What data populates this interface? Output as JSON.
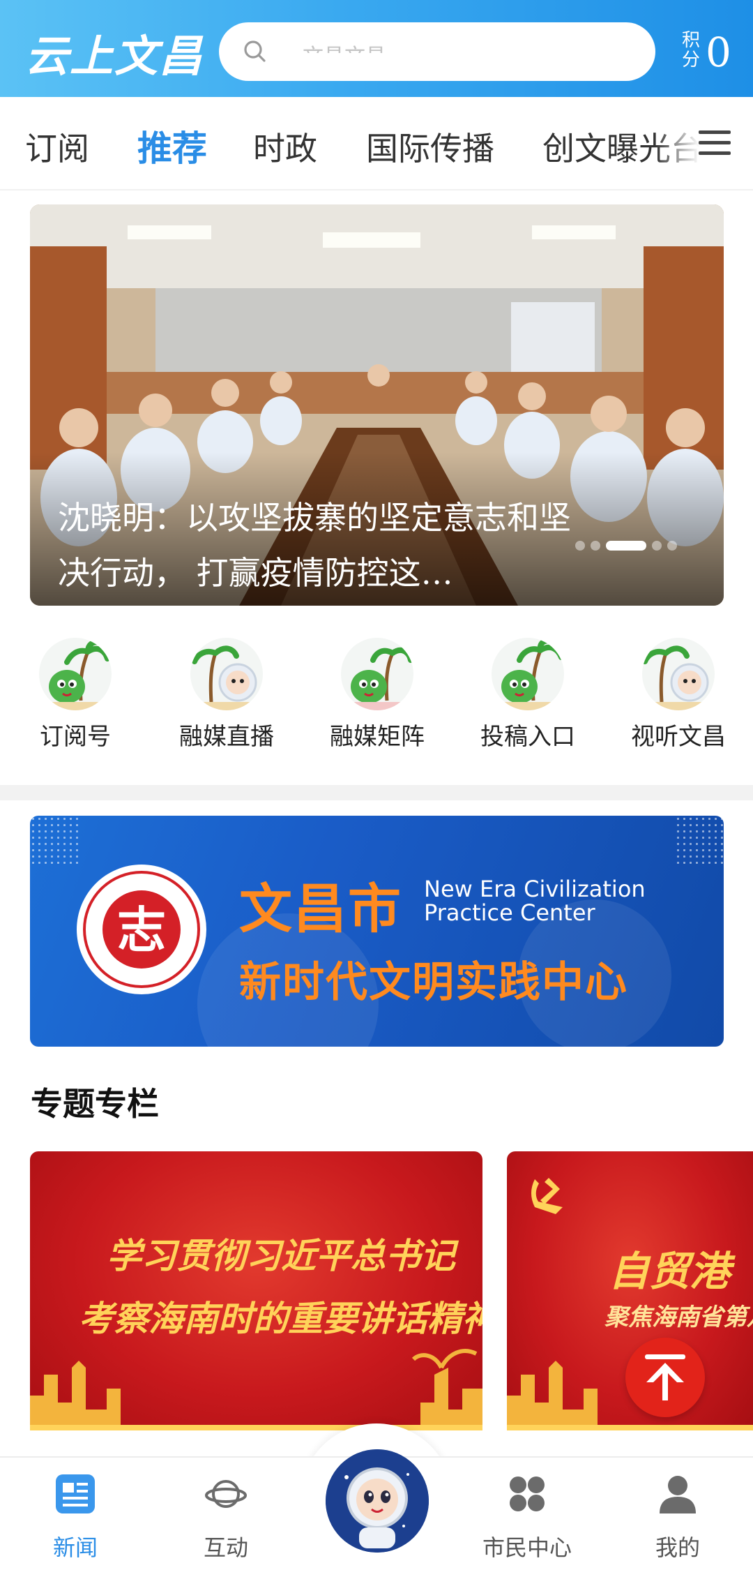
{
  "header": {
    "logo_text": "云上文昌",
    "search_placeholder": "文昌文昌",
    "score_label": "积分",
    "score_value": "0",
    "brand_color": "#2a8de6"
  },
  "tabs": [
    {
      "label": "订阅",
      "active": false
    },
    {
      "label": "推荐",
      "active": true
    },
    {
      "label": "时政",
      "active": false
    },
    {
      "label": "国际传播",
      "active": false
    },
    {
      "label": "创文曝光台",
      "active": false
    }
  ],
  "carousel": {
    "caption": "沈晓明：以攻坚拔寨的坚定意志和坚决行动， 打赢疫情防控这…",
    "slide_count": 5,
    "active_slide": 3
  },
  "quick_links": [
    {
      "label": "订阅号",
      "icon": "mascot-palm-icon"
    },
    {
      "label": "融媒直播",
      "icon": "mascot-astronaut-icon"
    },
    {
      "label": "融媒矩阵",
      "icon": "mascot-palm-icon"
    },
    {
      "label": "投稿入口",
      "icon": "mascot-palm-icon"
    },
    {
      "label": "视听文昌",
      "icon": "mascot-astronaut-icon"
    }
  ],
  "banner": {
    "title": "文昌市",
    "subtitle": "新时代文明实践中心",
    "english_line1": "New Era Civilization",
    "english_line2": "Practice Center",
    "seal_text": "志"
  },
  "section": {
    "title": "专题专栏",
    "topics": [
      {
        "line1": "学习贯彻习近平总书记",
        "line2": "考察海南时的重要讲话精神"
      },
      {
        "line1": "自贸港",
        "line2": "聚焦海南省第八"
      }
    ]
  },
  "bottom_nav": [
    {
      "label": "新闻",
      "icon": "news-icon",
      "active": true
    },
    {
      "label": "互动",
      "icon": "planet-icon",
      "active": false
    },
    {
      "label": "",
      "icon": "astronaut-mascot-icon",
      "active": false
    },
    {
      "label": "市民中心",
      "icon": "grid-icon",
      "active": false
    },
    {
      "label": "我的",
      "icon": "user-icon",
      "active": false
    }
  ]
}
